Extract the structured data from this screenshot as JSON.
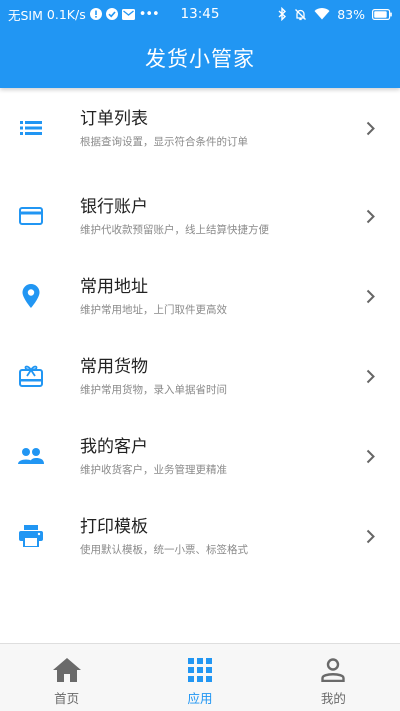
{
  "status_bar": {
    "carrier": "无SIM",
    "speed": "0.1K/s",
    "time": "13:45",
    "battery": "83%"
  },
  "app": {
    "title": "发货小管家",
    "accent_color": "#2196f3"
  },
  "menu_items": [
    {
      "icon": "list-icon",
      "title": "订单列表",
      "subtitle": "根据查询设置，显示符合条件的订单"
    },
    {
      "icon": "credit-card-icon",
      "title": "银行账户",
      "subtitle": "维护代收款预留账户，线上结算快捷方便"
    },
    {
      "icon": "location-pin-icon",
      "title": "常用地址",
      "subtitle": "维护常用地址，上门取件更高效"
    },
    {
      "icon": "gift-card-icon",
      "title": "常用货物",
      "subtitle": "维护常用货物，录入单据省时间"
    },
    {
      "icon": "people-icon",
      "title": "我的客户",
      "subtitle": "维护收货客户，业务管理更精准"
    },
    {
      "icon": "printer-icon",
      "title": "打印模板",
      "subtitle": "使用默认模板，统一小票、标签格式"
    }
  ],
  "bottom_nav": [
    {
      "icon": "home-icon",
      "label": "首页",
      "active": false
    },
    {
      "icon": "apps-grid-icon",
      "label": "应用",
      "active": true
    },
    {
      "icon": "person-icon",
      "label": "我的",
      "active": false
    }
  ]
}
